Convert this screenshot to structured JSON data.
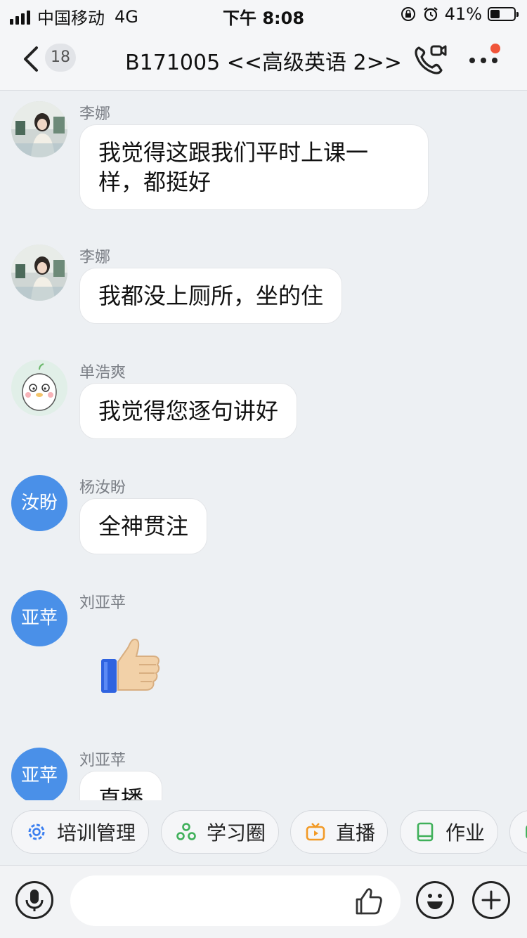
{
  "status_bar": {
    "carrier": "中国移动",
    "network": "4G",
    "time": "下午 8:08",
    "battery_percent": "41%",
    "battery_level": 0.41
  },
  "nav": {
    "back_count": "18",
    "title": "B171005 <<高级英语 2>>"
  },
  "messages": [
    {
      "sender": "李娜",
      "avatar_type": "photo",
      "text": "我觉得这跟我们平时上课一样，都挺好"
    },
    {
      "sender": "李娜",
      "avatar_type": "photo",
      "text": "我都没上厕所，坐的住"
    },
    {
      "sender": "单浩爽",
      "avatar_type": "cartoon",
      "text": "我觉得您逐句讲好"
    },
    {
      "sender": "杨汝盼",
      "avatar_type": "text",
      "avatar_text": "汝盼",
      "text": "全神贯注"
    },
    {
      "sender": "刘亚苹",
      "avatar_type": "text",
      "avatar_text": "亚苹",
      "emoji": "thumbs-up-icon"
    },
    {
      "sender": "刘亚苹",
      "avatar_type": "text",
      "avatar_text": "亚苹",
      "text": "直播"
    }
  ],
  "quick_actions": [
    {
      "label": "培训管理",
      "icon": "gear-icon",
      "color": "#3b7ff0"
    },
    {
      "label": "学习圈",
      "icon": "circle-group-icon",
      "color": "#3fb05a"
    },
    {
      "label": "直播",
      "icon": "tv-icon",
      "color": "#f29a26"
    },
    {
      "label": "作业",
      "icon": "book-icon",
      "color": "#3fb05a"
    }
  ],
  "input": {
    "value": "",
    "placeholder": ""
  },
  "colors": {
    "avatar_blue": "#4a90e8",
    "notification_red": "#f0553a",
    "background": "#edf0f3"
  }
}
